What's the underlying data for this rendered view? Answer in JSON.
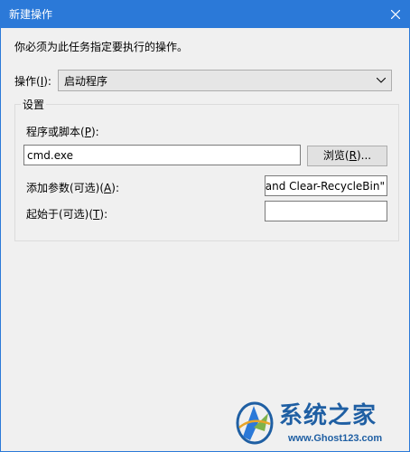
{
  "window": {
    "title": "新建操作"
  },
  "instruction": "你必须为此任务指定要执行的操作。",
  "action": {
    "label_prefix": "操作(",
    "label_key": "I",
    "label_suffix": "):",
    "selected_value": "启动程序"
  },
  "settings": {
    "group_title": "设置",
    "program": {
      "label_prefix": "程序或脚本(",
      "label_key": "P",
      "label_suffix": "):",
      "value": "cmd.exe"
    },
    "browse_button": {
      "label_prefix": "浏览(",
      "label_key": "R",
      "label_suffix": ")..."
    },
    "arguments": {
      "label_prefix": "添加参数(可选)(",
      "label_key": "A",
      "label_suffix": "):",
      "value": "and Clear-RecycleBin\""
    },
    "start_in": {
      "label_prefix": "起始于(可选)(",
      "label_key": "T",
      "label_suffix": "):",
      "value": ""
    }
  },
  "watermark": {
    "brand": "系统之家",
    "url": "www.Ghost123.com"
  },
  "colors": {
    "titlebar": "#2b79d8",
    "background": "#f0f0f0",
    "watermark": "#1f5fa3"
  }
}
